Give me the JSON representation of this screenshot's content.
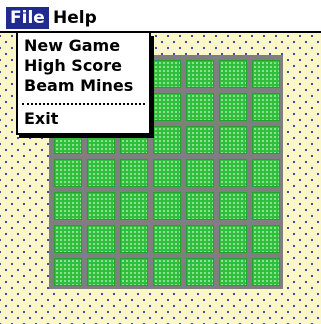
{
  "menubar": {
    "file_label": "File",
    "help_label": "Help"
  },
  "file_menu": {
    "items": [
      {
        "label": "New Game"
      },
      {
        "label": "High Score"
      },
      {
        "label": "Beam Mines"
      }
    ],
    "exit_label": "Exit"
  },
  "board": {
    "rows": 7,
    "cols": 7
  },
  "colors": {
    "background": "#fbf7c8",
    "dots": "#2a3aa8",
    "tile": "#2fbf3c",
    "grid": "#7f7f7f",
    "menu_highlight": "#1f2b8e"
  }
}
